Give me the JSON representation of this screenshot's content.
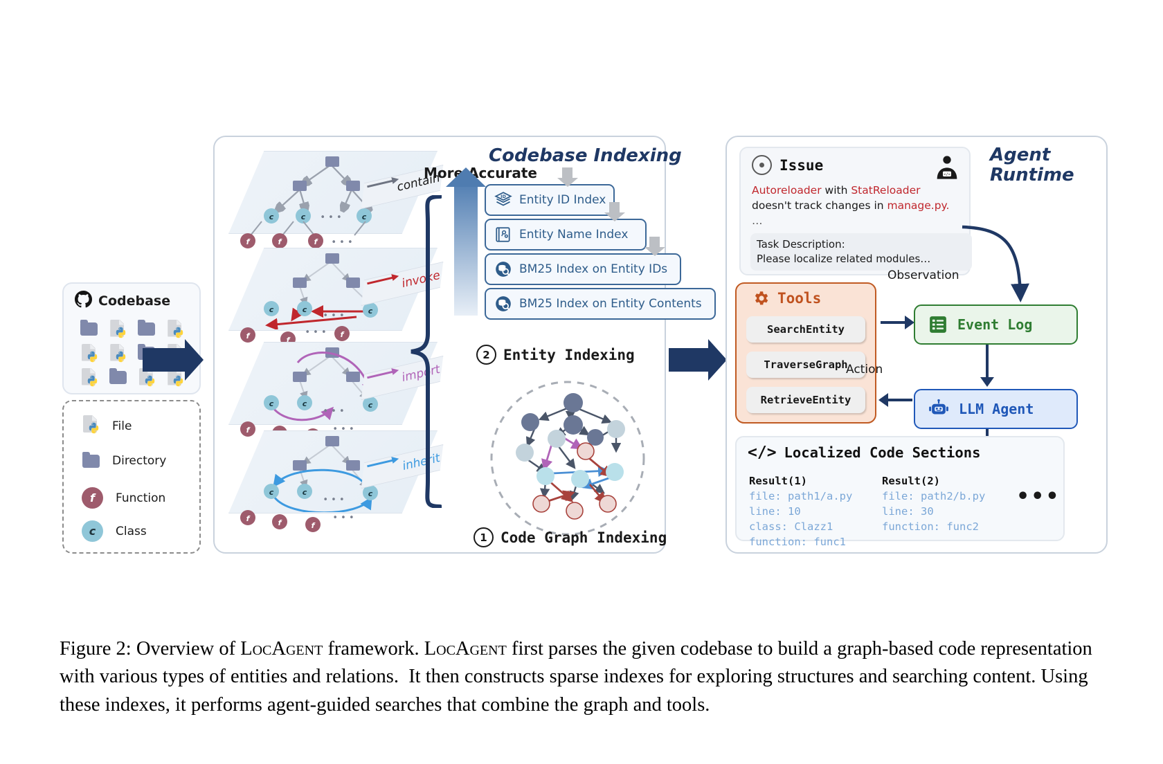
{
  "figure": {
    "caption_prefix": "Figure 2:",
    "caption": " Overview of LOCAGENT framework. LOCAGENT first parses the given codebase to build a graph-based code representation with various types of entities and relations. It then constructs sparse indexes for exploring structures and searching content. Using these indexes, it performs agent-guided searches that combine the graph and tools."
  },
  "codebase": {
    "title": "Codebase",
    "icon": "github-icon",
    "grid": [
      "directory",
      "file",
      "directory",
      "file",
      "file",
      "file",
      "directory",
      "file",
      "file",
      "directory",
      "file",
      "file"
    ]
  },
  "legend": {
    "items": [
      {
        "icon": "python-file-icon",
        "label": "File"
      },
      {
        "icon": "folder-icon",
        "label": "Directory"
      },
      {
        "icon": "function-node-icon",
        "glyph": "f",
        "label": "Function"
      },
      {
        "icon": "class-node-icon",
        "glyph": "c",
        "label": "Class"
      }
    ]
  },
  "indexing": {
    "title": "Codebase Indexing",
    "more_accurate": "More Accurate",
    "relations": [
      {
        "label": "contain",
        "color": "#6e7482"
      },
      {
        "label": "invoke",
        "color": "#c0272d"
      },
      {
        "label": "import",
        "color": "#b064b8"
      },
      {
        "label": "inherit",
        "color": "#3d9ae0"
      }
    ],
    "index_boxes": [
      {
        "label": "Entity ID Index",
        "icon": "id-stack-icon"
      },
      {
        "label": "Entity Name Index",
        "icon": "name-book-icon"
      },
      {
        "label": "BM25 Index on Entity IDs",
        "icon": "bm25-db-icon"
      },
      {
        "label": "BM25 Index on Entity Contents",
        "icon": "bm25-db-icon"
      }
    ],
    "step_entity": {
      "num": "2",
      "label": "Entity Indexing"
    },
    "step_graph": {
      "num": "1",
      "label": "Code Graph Indexing"
    }
  },
  "runtime": {
    "title_line1": "Agent",
    "title_line2": "Runtime",
    "issue": {
      "title": "Issue",
      "icon": "issue-circle-icon",
      "dev_icon": "developer-icon",
      "text_part1": "Autoreloader",
      "text_part2": " with ",
      "text_part3": "StatReloader",
      "text_part4": "doesn't track changes in ",
      "text_part5": "manage.py",
      "text_part6": ".",
      "ellipsis": "…",
      "task_title": "Task Description:",
      "task_text": "Please localize related modules…"
    },
    "tools": {
      "title": "Tools",
      "icon": "gear-icon",
      "items": [
        "SearchEntity",
        "TraverseGraph",
        "RetrieveEntity"
      ]
    },
    "event_log": {
      "label": "Event Log",
      "icon": "list-icon"
    },
    "llm_agent": {
      "label": "LLM Agent",
      "icon": "robot-icon"
    },
    "flow": {
      "observation": "Observation",
      "action": "Action"
    },
    "localized": {
      "title": "Localized Code Sections",
      "icon": "code-tag-icon",
      "results": [
        {
          "header": "Result(1)",
          "lines": [
            "file: path1/a.py",
            "line: 10",
            "class: Clazz1",
            "function: func1"
          ]
        },
        {
          "header": "Result(2)",
          "lines": [
            "file: path2/b.py",
            "line: 30",
            "function: func2"
          ]
        }
      ],
      "more": "•••"
    }
  },
  "colors": {
    "navy": "#1f3864",
    "function": "#9e5b6c",
    "class": "#8fc6d8",
    "directory": "#8089ab",
    "tools_border": "#c05a22",
    "event_green": "#2f7d32",
    "llm_blue": "#2058b8",
    "red": "#c0272d"
  }
}
